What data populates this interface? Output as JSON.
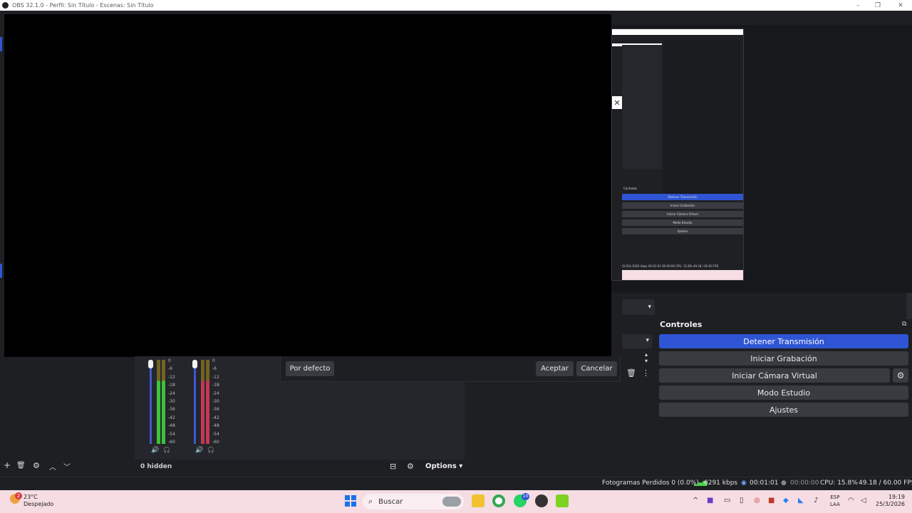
{
  "window": {
    "title": "OBS 32.1.0 - Perfil: Sin Título - Escenas: Sin Título",
    "minimize_icon": "–",
    "maximize_icon": "❐",
    "close_icon": "✕"
  },
  "thumbnail": {
    "close_glyph": "✕",
    "controls_header": "Controles",
    "buttons": [
      "Detener Transmisión",
      "Iniciar Grabación",
      "Iniciar Cámara Virtual",
      "Modo Estudio",
      "Ajustes"
    ],
    "status": "(0.0%)   6291 kbps   00:01:01   00:00:00   CPU: 15.8%   49.18 / 60.00 FPS"
  },
  "controls": {
    "title": "Controles",
    "float_icon": "⧉",
    "stop_stream": "Detener Transmisión",
    "start_recording": "Iniciar Grabación",
    "start_virtual_cam": "Iniciar Cámara Virtual",
    "studio_mode": "Modo Estudio",
    "settings": "Ajustes",
    "gear_icon": "⚙"
  },
  "transitions": {
    "caret": "▾",
    "spin_up": "▴",
    "spin_down": "▾",
    "trash_icon": "🗑",
    "more_icon": "⋮"
  },
  "dialog": {
    "defaults": "Por defecto",
    "accept": "Aceptar",
    "cancel": "Cancelar"
  },
  "mixer": {
    "scale": [
      "0",
      "-6",
      "-12",
      "-18",
      "-24",
      "-30",
      "-36",
      "-42",
      "-48",
      "-54",
      "-60"
    ],
    "channels": [
      {
        "volume_level": 1.0,
        "meter_color": "#3fd43f",
        "mute_icon": "🔊",
        "monitor_icon": "🎧"
      },
      {
        "volume_level": 1.0,
        "meter_color": "#d43a5a",
        "mute_icon": "🔊",
        "monitor_icon": "🎧"
      }
    ],
    "hidden_count": "0 hidden",
    "options": "Options",
    "options_caret": "▾",
    "layout_icon": "⊟",
    "gears_icon": "⚙"
  },
  "scenes_toolbar": {
    "add": "+",
    "remove": "🗑",
    "filters": "⚙",
    "up": "︿",
    "down": "﹀"
  },
  "status": {
    "dropped_frames": "Fotogramas Perdidos 0 (0.0%)",
    "bitrate": "6291 kbps",
    "stream_time": "00:01:01",
    "record_time": "00:00:00",
    "cpu": "CPU: 15.8%",
    "fps": "49.18 / 60.00 FPS",
    "accent_live": "#2f55d4"
  },
  "taskbar": {
    "temperature": "23°C",
    "weather": "Despejado",
    "weather_badge": "2",
    "search": "Buscar",
    "whatsapp_badge": "10",
    "lang_top": "ESP",
    "lang_bottom": "LAA",
    "time": "19:19",
    "date": "25/3/2026"
  }
}
